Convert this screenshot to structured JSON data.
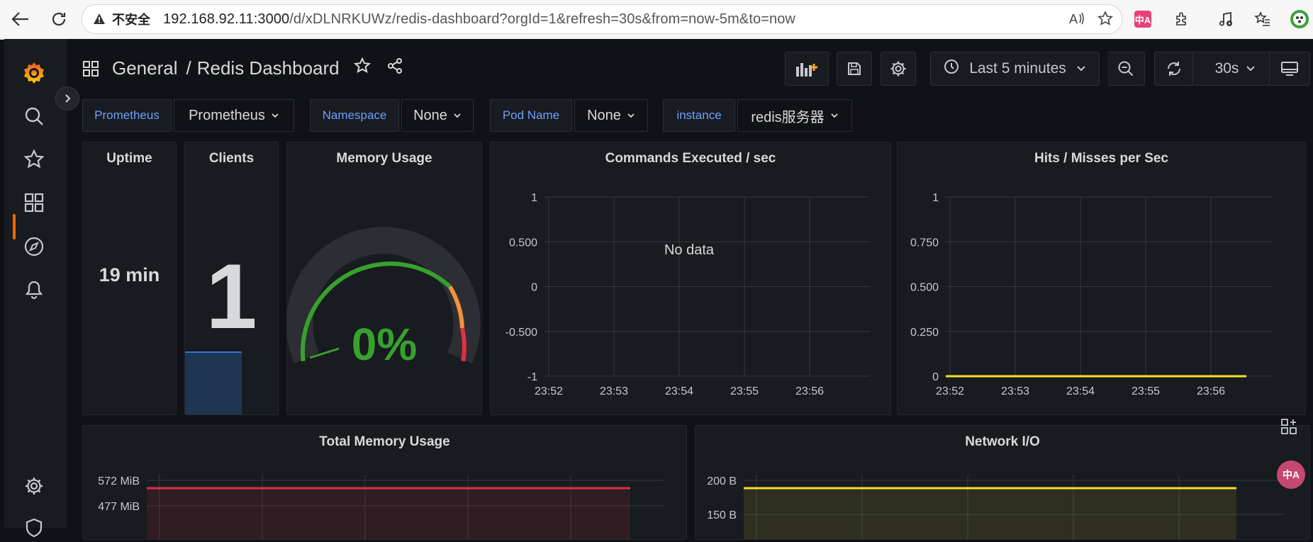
{
  "browser": {
    "insecure_label": "不安全",
    "url_host": "192.168.92.11:3000",
    "url_path": "/d/xDLNRKUWz/redis-dashboard?orgId=1&refresh=30s&from=now-5m&to=now",
    "translate_ext": "中A",
    "right_icons": [
      "read-aloud-icon",
      "favorite-star-icon"
    ]
  },
  "header": {
    "folder": "General",
    "separator": "/",
    "dashboard": "Redis Dashboard",
    "time_range": "Last 5 minutes",
    "refresh_interval": "30s"
  },
  "variables": [
    {
      "label": "Prometheus",
      "value": "Prometheus"
    },
    {
      "label": "Namespace",
      "value": "None"
    },
    {
      "label": "Pod Name",
      "value": "None"
    },
    {
      "label": "instance",
      "value": "redis服务器"
    }
  ],
  "panels": {
    "uptime": {
      "title": "Uptime",
      "value": "19 min"
    },
    "clients": {
      "title": "Clients",
      "value": "1"
    },
    "memory_usage": {
      "title": "Memory Usage",
      "value": "0%",
      "percent": 0
    },
    "commands": {
      "title": "Commands Executed / sec",
      "empty_text": "No data"
    },
    "hits_misses": {
      "title": "Hits / Misses per Sec"
    },
    "total_memory": {
      "title": "Total Memory Usage"
    },
    "network_io": {
      "title": "Network I/O"
    }
  },
  "colors": {
    "accent": "#f46800",
    "green": "#37872d",
    "gauge_green": "#37a12d",
    "yellow": "#fade2a",
    "red": "#e02f44",
    "link_blue": "#6e9fff"
  },
  "chart_data": [
    {
      "type": "line",
      "title": "Commands Executed / sec",
      "x": [
        "23:52",
        "23:53",
        "23:54",
        "23:55",
        "23:56"
      ],
      "yticks": [
        "1",
        "0.500",
        "0",
        "-0.500",
        "-1"
      ],
      "ylim": [
        -1,
        1
      ],
      "series": [],
      "annotation": "No data",
      "grid": true
    },
    {
      "type": "line",
      "title": "Hits / Misses per Sec",
      "x": [
        "23:52",
        "23:53",
        "23:54",
        "23:55",
        "23:56"
      ],
      "yticks": [
        "1",
        "0.750",
        "0.500",
        "0.250",
        "0"
      ],
      "ylim": [
        0,
        1
      ],
      "series": [
        {
          "values": [
            0,
            0,
            0,
            0,
            0
          ]
        }
      ],
      "grid": true
    },
    {
      "type": "area",
      "title": "Total Memory Usage",
      "yticks": [
        "572 MiB",
        "477 MiB"
      ],
      "series": [
        {
          "values": [
            477,
            477,
            477,
            477,
            477
          ]
        }
      ],
      "grid": true
    },
    {
      "type": "area",
      "title": "Network I/O",
      "yticks": [
        "200 B",
        "150 B"
      ],
      "series": [
        {
          "values": [
            175,
            175,
            175,
            175,
            175
          ]
        }
      ],
      "grid": true
    }
  ]
}
